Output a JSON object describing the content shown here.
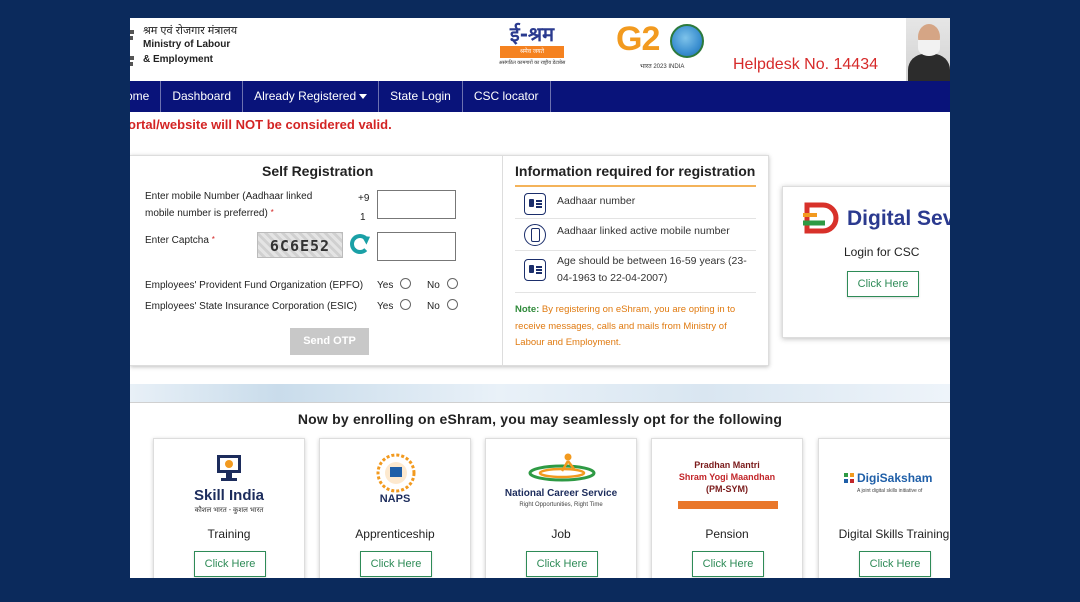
{
  "header": {
    "ministry_hindi": "श्रम एवं रोजगार मंत्रालय",
    "ministry_en_line1": "Ministry of Labour",
    "ministry_en_line2": "& Employment",
    "eshram_logo_text": "ई-श्रम",
    "eshram_badge": "श्रमेव जयते",
    "eshram_tagline": "असंगठित कामगारों का राष्ट्रीय डेटाबेस",
    "g20_text": "G2",
    "g20_subtext": "भारत 2023 INDIA",
    "helpdesk": "Helpdesk No. 14434"
  },
  "nav": {
    "items": [
      {
        "label": "ome"
      },
      {
        "label": "Dashboard"
      },
      {
        "label": "Already Registered"
      },
      {
        "label": "State Login"
      },
      {
        "label": "CSC locator"
      }
    ]
  },
  "warning_text": "ortal/website will NOT be considered valid.",
  "self_registration": {
    "title": "Self Registration",
    "mobile_label_line1": "Enter mobile Number (Aadhaar linked",
    "mobile_label_line2": "mobile number is preferred)",
    "mobile_prefix_line1": "+9",
    "mobile_prefix_line2": "1",
    "mobile_value": "",
    "captcha_label": "Enter Captcha",
    "captcha_code": "6C6E52",
    "captcha_value": "",
    "required_mark": "*",
    "epfo_label": "Employees' Provident Fund Organization (EPFO)",
    "esic_label": "Employees' State Insurance Corporation (ESIC)",
    "yes_label": "Yes",
    "no_label": "No",
    "send_otp_label": "Send OTP"
  },
  "info": {
    "title": "Information required for registration",
    "items": [
      {
        "text": "Aadhaar number",
        "icon": "id-card-icon"
      },
      {
        "text": "Aadhaar linked active mobile number",
        "icon": "mobile-phone-icon"
      },
      {
        "text": "Age should be between 16-59 years (23-04-1963 to 22-04-2007)",
        "icon": "id-card-icon"
      }
    ],
    "note_label": "Note:",
    "note_text": " By registering on eShram, you are opting in to receive messages, calls and mails from Ministry of Labour and Employment."
  },
  "csc": {
    "logo_text": "Digital Sev",
    "label": "Login for CSC",
    "button_label": "Click Here"
  },
  "enroll_heading": "Now by enrolling on eShram, you may seamlessly opt for the following",
  "schemes": [
    {
      "label": "Training",
      "logo_line1": "Skill India",
      "logo_line2": "कौशल भारत - कुशल भारत",
      "button_label": "Click Here"
    },
    {
      "label": "Apprenticeship",
      "logo_line1": "NAPS",
      "logo_line2": "",
      "button_label": "Click Here"
    },
    {
      "label": "Job",
      "logo_line1": "National Career Service",
      "logo_line2": "Right Opportunities, Right Time",
      "button_label": "Click Here"
    },
    {
      "label": "Pension",
      "logo_line1": "Pradhan Mantri",
      "logo_line2": "Shram Yogi Maandhan",
      "logo_line3": "(PM-SYM)",
      "button_label": "Click Here"
    },
    {
      "label": "Digital Skills Training",
      "logo_line1": "DigiSaksham",
      "logo_line2": "A joint digital skills initiative of",
      "button_label": "Click Here"
    }
  ],
  "colors": {
    "nav_bg": "#09137a",
    "warning": "#d32424",
    "accent_green": "#2e8b57",
    "helpdesk": "#d62a2a",
    "page_frame": "#0b2a5c"
  }
}
